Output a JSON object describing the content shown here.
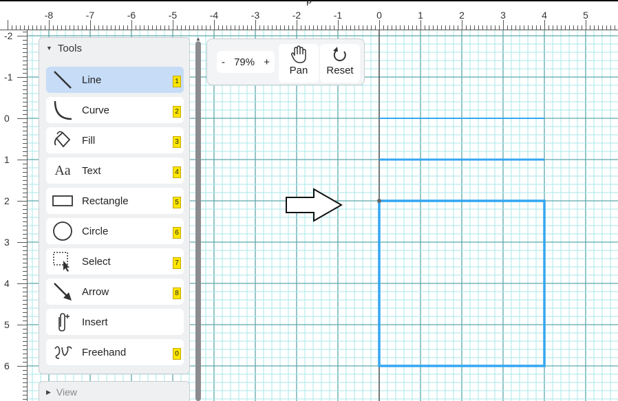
{
  "ruler": {
    "caption": "p",
    "x_labels": [
      "-8",
      "-7",
      "-6",
      "-5",
      "-4",
      "-3",
      "-2",
      "-1",
      "0",
      "1",
      "2",
      "3",
      "4",
      "5"
    ],
    "y_labels": [
      "-2",
      "-1",
      "0",
      "1",
      "2",
      "3",
      "4",
      "5",
      "6"
    ]
  },
  "tools": {
    "header": "Tools",
    "items": [
      {
        "label": "Line",
        "key": "1",
        "icon": "line-icon",
        "selected": true
      },
      {
        "label": "Curve",
        "key": "2",
        "icon": "curve-icon"
      },
      {
        "label": "Fill",
        "key": "3",
        "icon": "fill-bucket-icon"
      },
      {
        "label": "Text",
        "key": "4",
        "icon": "text-icon",
        "icon_text": "Aa"
      },
      {
        "label": "Rectangle",
        "key": "5",
        "icon": "rectangle-icon"
      },
      {
        "label": "Circle",
        "key": "6",
        "icon": "circle-icon"
      },
      {
        "label": "Select",
        "key": "7",
        "icon": "select-icon"
      },
      {
        "label": "Arrow",
        "key": "8",
        "icon": "arrow-icon"
      },
      {
        "label": "Insert",
        "key": "",
        "icon": "paperclip-icon"
      },
      {
        "label": "Freehand",
        "key": "0",
        "icon": "freehand-icon"
      }
    ]
  },
  "view": {
    "header": "View"
  },
  "zoom": {
    "minus": "-",
    "level": "79%",
    "plus": "+",
    "pan_label": "Pan",
    "reset_label": "Reset"
  },
  "colors": {
    "grid_minor": "#a7e7ea",
    "grid_major": "#5ba8aa",
    "shape_blue": "#34a6f0",
    "selected_tool": "#c6dcf7",
    "key_badge": "#ffe600"
  }
}
